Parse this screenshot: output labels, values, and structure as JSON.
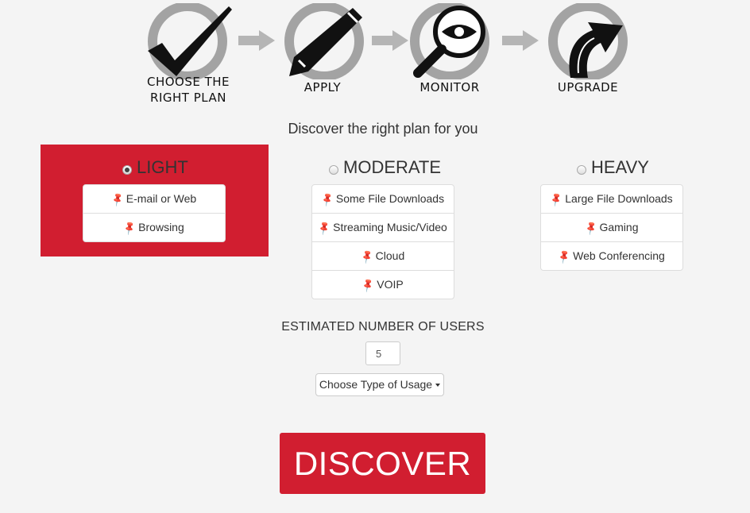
{
  "steps": [
    {
      "label": "CHOOSE THE\nRIGHT PLAN",
      "icon": "checkmark-icon"
    },
    {
      "label": "APPLY",
      "icon": "pencil-icon"
    },
    {
      "label": "MONITOR",
      "icon": "magnifier-eye-icon"
    },
    {
      "label": "UPGRADE",
      "icon": "upgrade-arrow-icon"
    }
  ],
  "subtitle": "Discover the right plan for you",
  "plans": {
    "light": {
      "title": "LIGHT",
      "selected": true,
      "items": [
        "E-mail or Web",
        "Browsing"
      ]
    },
    "moderate": {
      "title": "MODERATE",
      "selected": false,
      "items": [
        "Some File Downloads",
        "Streaming Music/Video",
        "Cloud",
        "VOIP"
      ]
    },
    "heavy": {
      "title": "HEAVY",
      "selected": false,
      "items": [
        "Large File Downloads",
        "Gaming",
        "Web Conferencing"
      ]
    }
  },
  "users": {
    "label": "ESTIMATED NUMBER OF USERS",
    "value": "5"
  },
  "usage_dropdown": {
    "label": "Choose Type of Usage"
  },
  "discover_button": {
    "label": "DISCOVER"
  },
  "colors": {
    "accent": "#d11e30",
    "ring": "#a3a3a3",
    "arrow": "#b5b5b5"
  }
}
